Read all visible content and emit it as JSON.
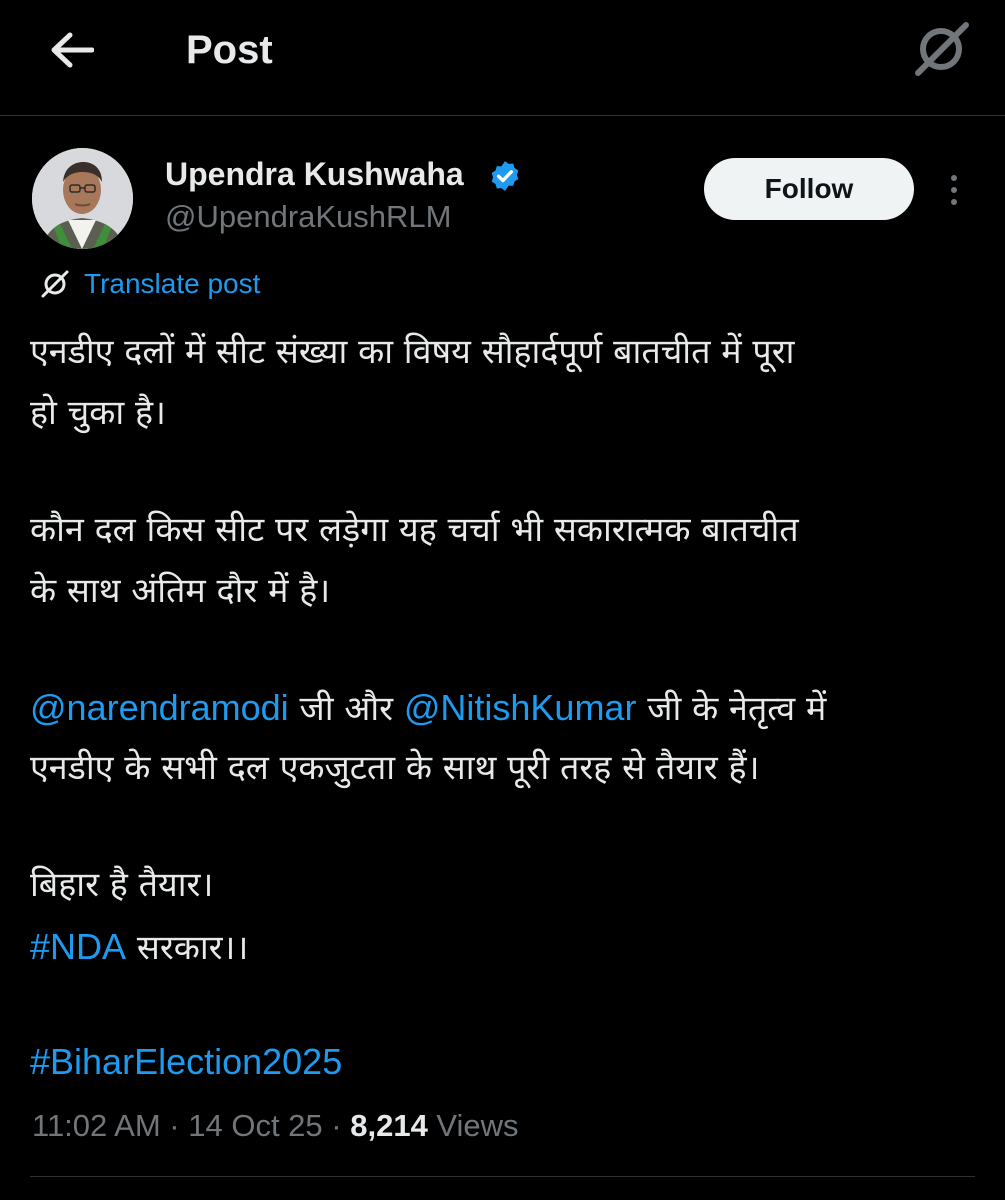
{
  "header": {
    "title": "Post",
    "back_icon": "arrow-left-icon",
    "grok_icon": "grok-icon"
  },
  "author": {
    "display_name": "Upendra Kushwaha",
    "handle": "@UpendraKushRLM",
    "verified": true,
    "verified_color": "#1d9bf0"
  },
  "actions": {
    "follow_label": "Follow",
    "more_icon": "more-vertical-icon"
  },
  "translate": {
    "label": "Translate post",
    "icon": "grok-translate-icon"
  },
  "post": {
    "line1": "एनडीए दलों में सीट संख्या का विषय सौहार्दपूर्ण बातचीत में पूरा",
    "line2": "हो चुका है।",
    "line3": "कौन दल किस सीट पर लड़ेगा यह चर्चा भी सकारात्मक बातचीत",
    "line4": "के साथ अंतिम दौर में है।",
    "mention1": "@narendramodi",
    "line5_mid": " जी और ",
    "mention2": "@NitishKumar",
    "line5_end": " जी के नेतृत्व में",
    "line6": "एनडीए के सभी दल एकजुटता के साथ पूरी तरह से तैयार हैं।",
    "line7": "बिहार है तैयार।",
    "hashtag1": "#NDA",
    "line8_end": " सरकार।।",
    "hashtag2": "#BiharElection2025"
  },
  "meta": {
    "time": "11:02 AM",
    "separator": " · ",
    "date": "14 Oct 25",
    "views_count": "8,214",
    "views_label": " Views"
  },
  "colors": {
    "background": "#000000",
    "text": "#e7e9ea",
    "secondary": "#71767b",
    "link": "#1d9bf0",
    "button_bg": "#eff3f4"
  }
}
